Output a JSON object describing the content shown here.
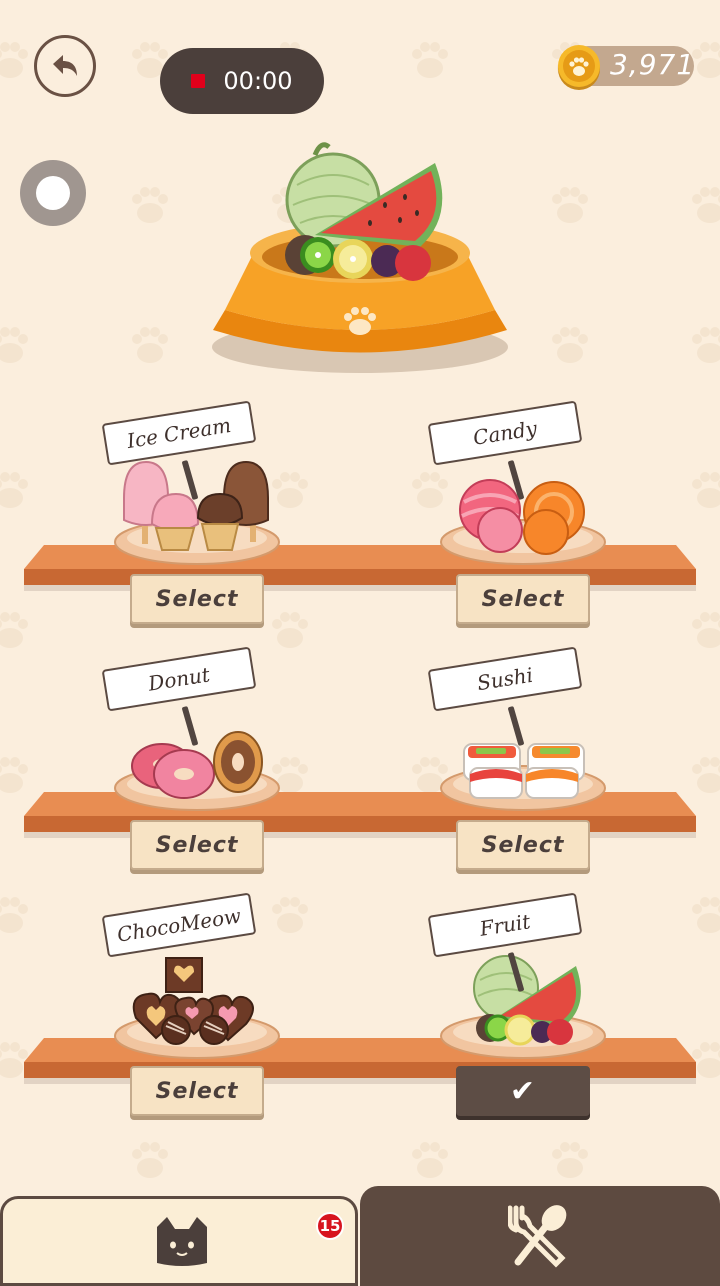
{
  "header": {
    "recording_time": "00:00",
    "coins": "3,971"
  },
  "foods": [
    {
      "id": "ice-cream",
      "label": "Ice Cream",
      "button": "Select",
      "selected": false
    },
    {
      "id": "candy",
      "label": "Candy",
      "button": "Select",
      "selected": false
    },
    {
      "id": "donut",
      "label": "Donut",
      "button": "Select",
      "selected": false
    },
    {
      "id": "sushi",
      "label": "Sushi",
      "button": "Select",
      "selected": false
    },
    {
      "id": "chocomeow",
      "label": "ChocoMeow",
      "button": "Select",
      "selected": false
    },
    {
      "id": "fruit",
      "label": "Fruit",
      "button": "✔",
      "selected": true
    }
  ],
  "tabs": {
    "cats_badge": "15"
  },
  "colors": {
    "background": "#fbeedd",
    "bowl": "#f19a22",
    "shelf": "#e0824a",
    "dark_brown": "#5d4a40",
    "badge": "#d7141f"
  },
  "icons": {
    "back": "back-arrow-icon",
    "coin": "paw-coin-icon",
    "cats_tab": "cat-face-icon",
    "food_tab": "fork-spoon-icon"
  }
}
